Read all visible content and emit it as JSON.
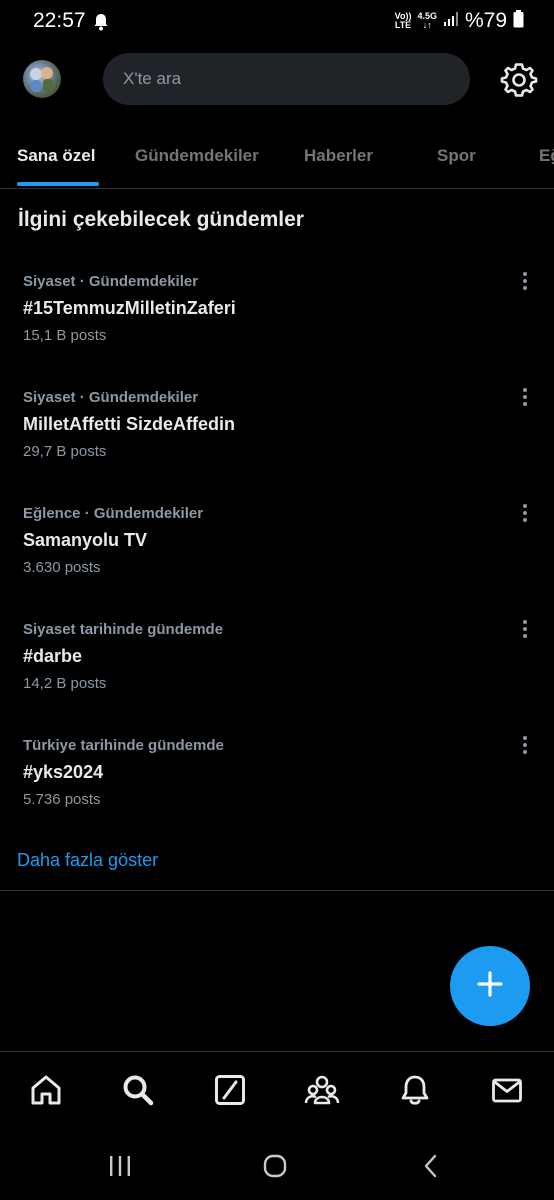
{
  "status_bar": {
    "time": "22:57",
    "volte_top": "Vo))",
    "volte_bottom": "LTE",
    "network_top": "4.5G",
    "network_bottom": "↓↑",
    "battery": "%79"
  },
  "header": {
    "search_placeholder": "X'te ara"
  },
  "tabs": [
    {
      "label": "Sana özel",
      "active": true
    },
    {
      "label": "Gündemdekiler",
      "active": false
    },
    {
      "label": "Haberler",
      "active": false
    },
    {
      "label": "Spor",
      "active": false
    },
    {
      "label": "Eğ",
      "active": false
    }
  ],
  "section": {
    "title": "İlgini çekebilecek gündemler"
  },
  "trends": [
    {
      "context": "Siyaset · Gündemdekiler",
      "name": "#15TemmuzMilletinZaferi",
      "count": "15,1 B posts"
    },
    {
      "context": "Siyaset · Gündemdekiler",
      "name": "MilletAffetti SizdeAffedin",
      "count": "29,7 B posts"
    },
    {
      "context": "Eğlence · Gündemdekiler",
      "name": "Samanyolu TV",
      "count": "3.630 posts"
    },
    {
      "context": "Siyaset tarihinde gündemde",
      "name": "#darbe",
      "count": "14,2 B posts"
    },
    {
      "context": "Türkiye tarihinde gündemde",
      "name": "#yks2024",
      "count": "5.736 posts"
    }
  ],
  "show_more": "Daha fazla göster",
  "colors": {
    "background": "#000000",
    "accent": "#1d9bf0",
    "secondary_text": "#8b98a5",
    "search_bg": "#202327"
  },
  "icons": {
    "fab": "plus-icon",
    "nav": [
      "home-icon",
      "search-icon",
      "grok-icon",
      "communities-icon",
      "notifications-icon",
      "messages-icon"
    ]
  }
}
